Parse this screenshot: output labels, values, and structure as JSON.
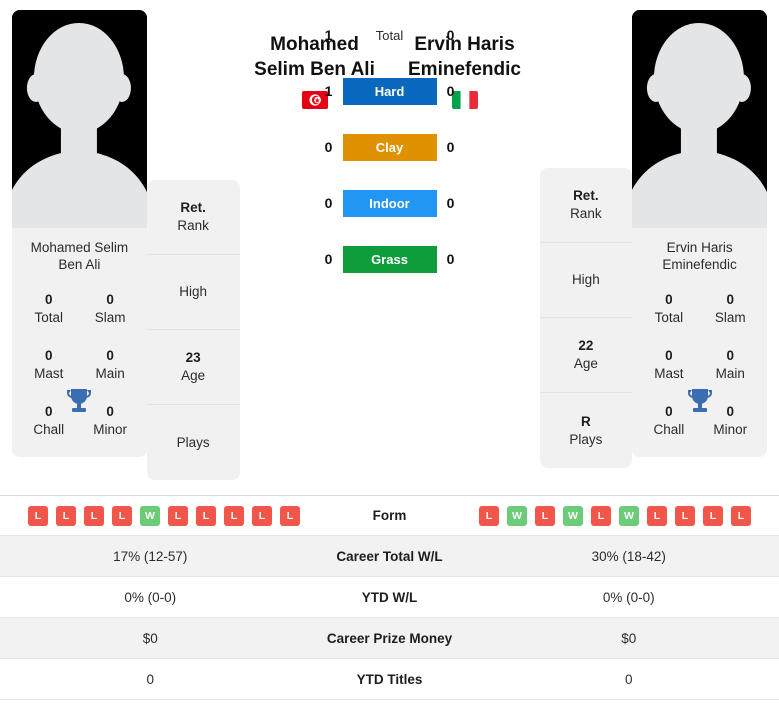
{
  "players": {
    "left": {
      "display_name_line1": "Mohamed",
      "display_name_line2": "Selim Ben Ali",
      "card_name": "Mohamed Selim Ben Ali",
      "country": "Tunisia",
      "flag": "tunisia-flag",
      "titles": [
        {
          "value": "0",
          "label": "Total"
        },
        {
          "value": "0",
          "label": "Slam"
        },
        {
          "value": "0",
          "label": "Mast"
        },
        {
          "value": "0",
          "label": "Main"
        },
        {
          "value": "0",
          "label": "Chall"
        },
        {
          "value": "0",
          "label": "Minor"
        }
      ],
      "info": [
        {
          "value": "Ret.",
          "label": "Rank"
        },
        {
          "value": "",
          "label": "High"
        },
        {
          "value": "23",
          "label": "Age"
        },
        {
          "value": "",
          "label": "Plays"
        }
      ],
      "form": [
        "L",
        "L",
        "L",
        "L",
        "W",
        "L",
        "L",
        "L",
        "L",
        "L"
      ]
    },
    "right": {
      "display_name_line1": "Ervin Haris",
      "display_name_line2": "Eminefendic",
      "card_name": "Ervin Haris Eminefendic",
      "country": "Italy",
      "flag": "italy-flag",
      "titles": [
        {
          "value": "0",
          "label": "Total"
        },
        {
          "value": "0",
          "label": "Slam"
        },
        {
          "value": "0",
          "label": "Mast"
        },
        {
          "value": "0",
          "label": "Main"
        },
        {
          "value": "0",
          "label": "Chall"
        },
        {
          "value": "0",
          "label": "Minor"
        }
      ],
      "info": [
        {
          "value": "Ret.",
          "label": "Rank"
        },
        {
          "value": "",
          "label": "High"
        },
        {
          "value": "22",
          "label": "Age"
        },
        {
          "value": "R",
          "label": "Plays"
        }
      ],
      "form": [
        "L",
        "W",
        "L",
        "W",
        "L",
        "W",
        "L",
        "L",
        "L",
        "L"
      ]
    }
  },
  "head_to_head": [
    {
      "label": "Total",
      "left": "1",
      "right": "0",
      "color": "",
      "plain": true
    },
    {
      "label": "Hard",
      "left": "1",
      "right": "0",
      "color": "#0a69bd",
      "plain": false
    },
    {
      "label": "Clay",
      "left": "0",
      "right": "0",
      "color": "#e09100",
      "plain": false
    },
    {
      "label": "Indoor",
      "left": "0",
      "right": "0",
      "color": "#2196f3",
      "plain": false
    },
    {
      "label": "Grass",
      "left": "0",
      "right": "0",
      "color": "#0f9d3c",
      "plain": false
    }
  ],
  "stats_rows": [
    {
      "label": "Form",
      "left": "",
      "right": "",
      "is_form": true
    },
    {
      "label": "Career Total W/L",
      "left": "17% (12-57)",
      "right": "30% (18-42)",
      "is_form": false
    },
    {
      "label": "YTD W/L",
      "left": "0% (0-0)",
      "right": "0% (0-0)",
      "is_form": false
    },
    {
      "label": "Career Prize Money",
      "left": "$0",
      "right": "$0",
      "is_form": false
    },
    {
      "label": "YTD Titles",
      "left": "0",
      "right": "0",
      "is_form": false
    }
  ],
  "colors": {
    "win": "#6bcb77",
    "loss": "#f0564a",
    "trophy": "#3a6eb0",
    "card_bg": "#f1f1f1"
  }
}
